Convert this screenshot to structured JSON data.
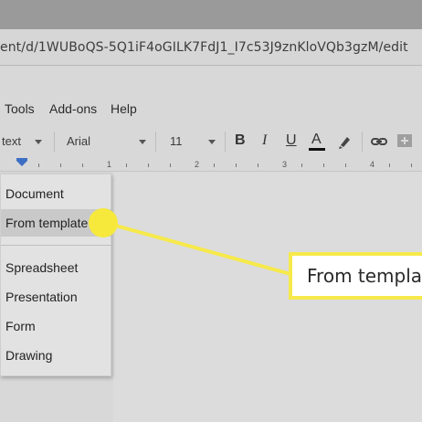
{
  "browser": {
    "url_fragment": "ent/d/1WUBoQS-5Q1iF4oGILK7FdJ1_I7c53J9znKloVQb3gzM/edit"
  },
  "menubar": {
    "items": [
      "Tools",
      "Add-ons",
      "Help"
    ]
  },
  "toolbar": {
    "style_value": "text",
    "font_value": "Arial",
    "size_value": "11",
    "bold_glyph": "B",
    "italic_glyph": "I",
    "underline_glyph": "U",
    "text_color_glyph": "A"
  },
  "ruler": {
    "numbers": [
      "1",
      "2",
      "3",
      "4"
    ],
    "marker_color": "#3d6fc4"
  },
  "dropdown": {
    "items": [
      {
        "label": "Document"
      },
      {
        "label": "From template"
      },
      {
        "label": "Spreadsheet"
      },
      {
        "label": "Presentation"
      },
      {
        "label": "Form"
      },
      {
        "label": "Drawing"
      }
    ],
    "highlighted": "From template"
  },
  "callout": {
    "text": "From template",
    "color": "#f7e93c"
  }
}
